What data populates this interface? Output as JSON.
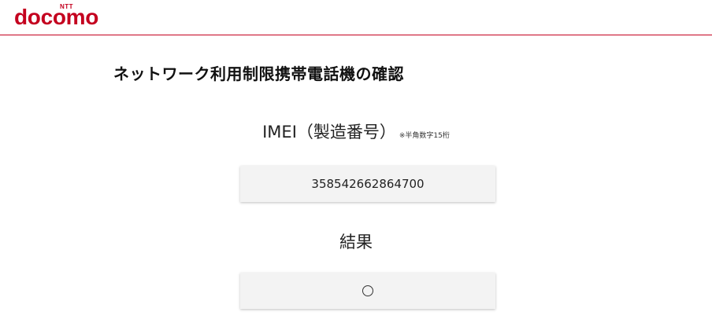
{
  "header": {
    "brand_top": "NTT",
    "brand_name": "docomo",
    "brand_color": "#c4001f"
  },
  "page": {
    "title": "ネットワーク利用制限携帯電話機の確認"
  },
  "imei": {
    "label": "IMEI（製造番号）",
    "note": "※半角数字15桁",
    "value": "358542662864700"
  },
  "result": {
    "label": "結果",
    "value": "○",
    "icon": "circle-mark-icon"
  }
}
